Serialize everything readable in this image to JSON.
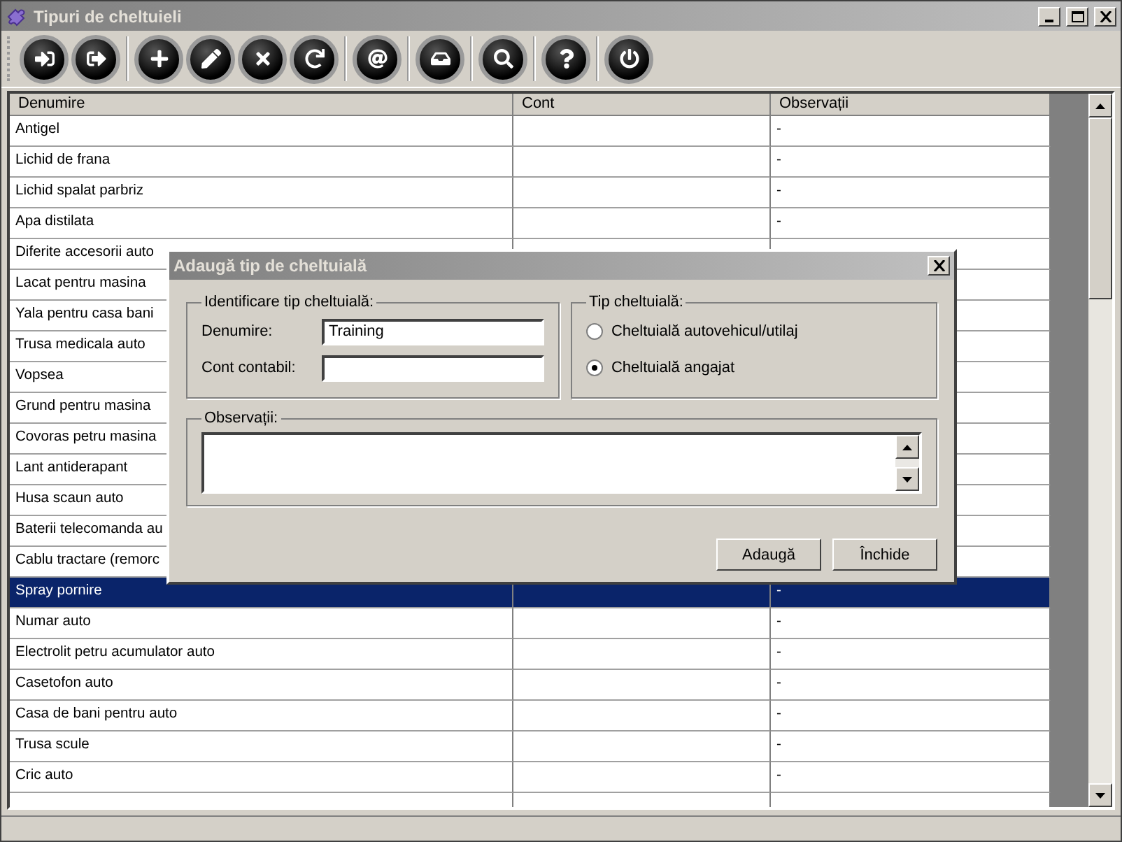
{
  "window": {
    "title": "Tipuri de cheltuieli"
  },
  "toolbar_groups": [
    [
      {
        "kind": "enter"
      },
      {
        "kind": "exit"
      }
    ],
    [
      {
        "kind": "add"
      },
      {
        "kind": "edit"
      },
      {
        "kind": "delete"
      },
      {
        "kind": "refresh"
      }
    ],
    [
      {
        "kind": "email"
      }
    ],
    [
      {
        "kind": "print"
      }
    ],
    [
      {
        "kind": "search"
      }
    ],
    [
      {
        "kind": "help"
      }
    ],
    [
      {
        "kind": "power"
      }
    ]
  ],
  "table": {
    "columns": [
      "Denumire",
      "Cont",
      "Observații"
    ],
    "rows": [
      {
        "name": "Antigel",
        "notes": "-",
        "selected": false
      },
      {
        "name": "Lichid de frana",
        "notes": "-",
        "selected": false
      },
      {
        "name": "Lichid spalat parbriz",
        "notes": "-",
        "selected": false
      },
      {
        "name": "Apa distilata",
        "notes": "-",
        "selected": false
      },
      {
        "name": "Diferite accesorii auto",
        "selected": false
      },
      {
        "name": "Lacat pentru masina",
        "selected": false
      },
      {
        "name": "Yala pentru casa bani",
        "selected": false
      },
      {
        "name": "Trusa medicala auto",
        "selected": false
      },
      {
        "name": "Vopsea",
        "selected": false
      },
      {
        "name": "Grund pentru masina",
        "selected": false
      },
      {
        "name": "Covoras petru masina",
        "selected": false
      },
      {
        "name": "Lant antiderapant",
        "selected": false
      },
      {
        "name": "Husa scaun auto",
        "selected": false
      },
      {
        "name": "Baterii telecomanda au",
        "selected": false
      },
      {
        "name": "Cablu tractare (remorc",
        "selected": false
      },
      {
        "name": "Spray pornire",
        "notes": "-",
        "selected": true
      },
      {
        "name": "Numar auto",
        "notes": "-",
        "selected": false
      },
      {
        "name": "Electrolit petru acumulator auto",
        "notes": "-",
        "selected": false
      },
      {
        "name": "Casetofon auto",
        "notes": "-",
        "selected": false
      },
      {
        "name": "Casa de bani pentru auto",
        "notes": "-",
        "selected": false
      },
      {
        "name": "Trusa scule",
        "notes": "-",
        "selected": false
      },
      {
        "name": "Cric auto",
        "notes": "-",
        "selected": false
      }
    ]
  },
  "dialog": {
    "title": "Adaugă tip de cheltuială",
    "identification": {
      "legend": "Identificare tip cheltuială:",
      "fields": [
        {
          "label": "Denumire:",
          "value": "Training"
        },
        {
          "label": "Cont contabil:"
        }
      ]
    },
    "type": {
      "legend": "Tip cheltuială:",
      "options": [
        {
          "label": "Cheltuială autovehicul/utilaj",
          "selected": false
        },
        {
          "label": "Cheltuială angajat",
          "selected": true
        }
      ]
    },
    "notes": {
      "legend": "Observații:"
    },
    "buttons": [
      "Adaugă",
      "Închide"
    ]
  }
}
